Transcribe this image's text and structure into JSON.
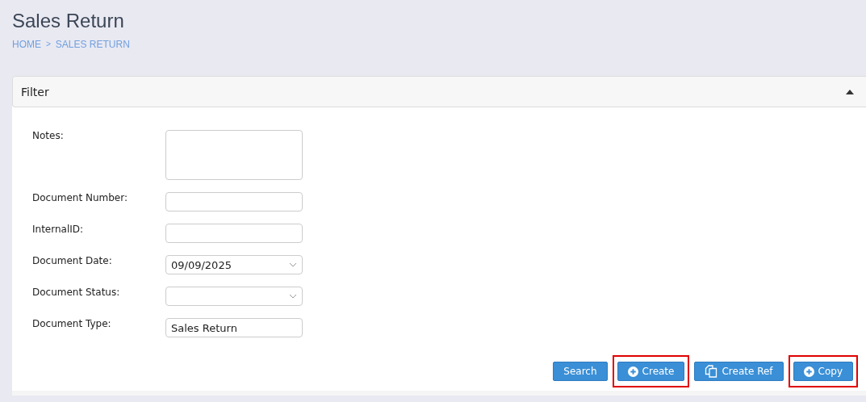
{
  "page": {
    "title": "Sales Return",
    "breadcrumb": [
      "HOME",
      ">",
      "SALES RETURN"
    ]
  },
  "filter": {
    "title": "Filter",
    "expanded": true,
    "fields": [
      {
        "label": "Notes:",
        "kind": "textarea"
      },
      {
        "label": "Document Number:",
        "kind": "text"
      },
      {
        "label": "InternalID:",
        "kind": "text"
      },
      {
        "label": "Document Date:",
        "kind": "select",
        "value": "09/09/2025"
      },
      {
        "label": "Document Status:",
        "kind": "select"
      },
      {
        "label": "Document Type:",
        "kind": "text",
        "value": "Sales Return"
      }
    ],
    "buttons": [
      {
        "label": "Search",
        "kind": "plain",
        "highlighted": false
      },
      {
        "label": "Create",
        "kind": "add",
        "highlighted": true
      },
      {
        "label": "Create Ref",
        "kind": "reference",
        "highlighted": false
      },
      {
        "label": "Copy",
        "kind": "add",
        "highlighted": true
      }
    ]
  }
}
